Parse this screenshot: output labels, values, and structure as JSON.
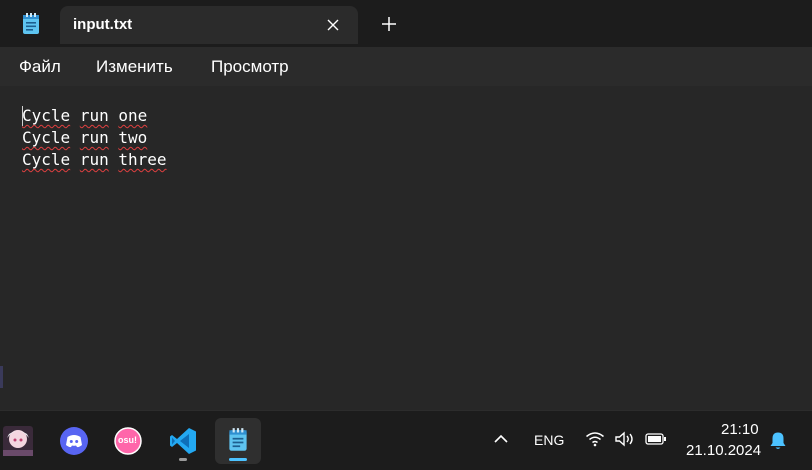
{
  "window": {
    "app_icon": "notepad-icon",
    "tab_title": "input.txt",
    "tab_close_icon": "close-icon",
    "new_tab_icon": "plus-icon"
  },
  "menu": {
    "items": [
      {
        "label": "Файл"
      },
      {
        "label": "Изменить"
      },
      {
        "label": "Просмотр"
      }
    ]
  },
  "editor": {
    "lines": [
      {
        "w1": "Cycle",
        "w2": "run",
        "w3": "one"
      },
      {
        "w1": "Cycle",
        "w2": "run",
        "w3": "two"
      },
      {
        "w1": "Cycle",
        "w2": "run",
        "w3": "three"
      }
    ],
    "spellcheck_color": "#e04040"
  },
  "taskbar": {
    "apps": [
      {
        "name": "anime-avatar-app-icon"
      },
      {
        "name": "discord-icon",
        "color": "#5865f2"
      },
      {
        "name": "osu-icon",
        "label": "osu!",
        "color": "#ff66aa"
      },
      {
        "name": "vscode-icon",
        "color": "#23a9f2"
      },
      {
        "name": "notepad-icon",
        "active": true,
        "indicator_color": "#4cc2ff"
      }
    ],
    "tray": {
      "overflow_icon": "chevron-up-icon",
      "language": "ENG",
      "wifi_icon": "wifi-icon",
      "volume_icon": "volume-icon",
      "battery_icon": "battery-icon",
      "time": "21:10",
      "date": "21.10.2024",
      "notification_icon": "bell-icon",
      "accent_color": "#4cc2ff"
    }
  }
}
